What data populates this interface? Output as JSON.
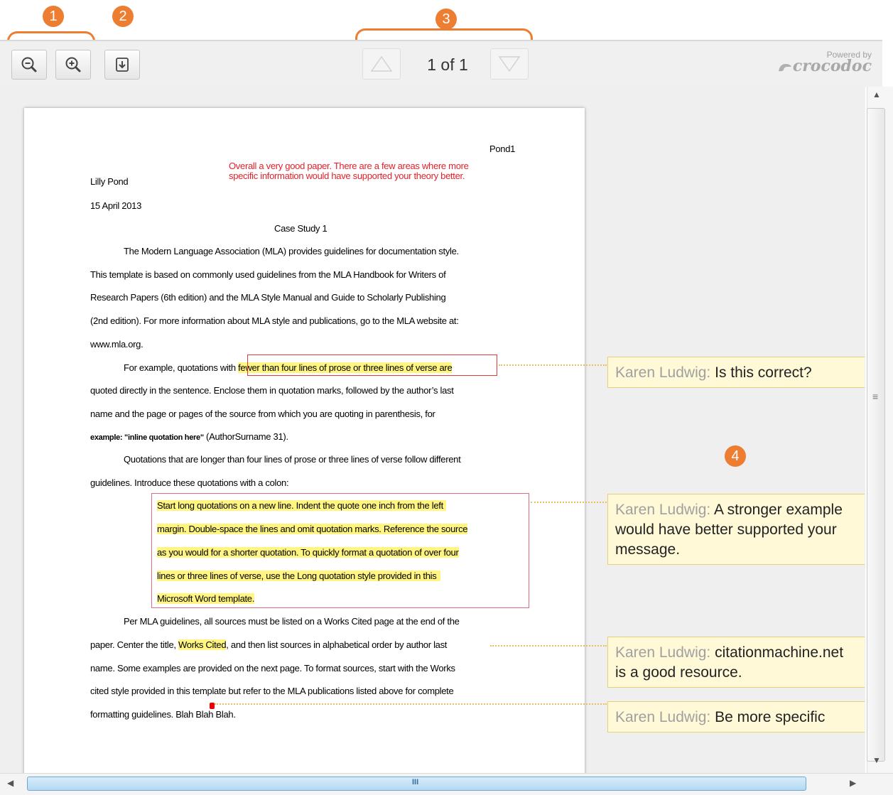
{
  "callouts": [
    "1",
    "2",
    "3",
    "4"
  ],
  "toolbar": {
    "zoom_out_icon": "zoom-out-icon",
    "zoom_in_icon": "zoom-in-icon",
    "download_icon": "download-icon",
    "page_indicator": "1 of 1",
    "brand_powered": "Powered by",
    "brand_name": "crocodoc"
  },
  "document": {
    "header_right": "Pond1",
    "author": "Lilly Pond",
    "date": "15 April 2013",
    "title": "Case Study 1",
    "general_comment": "Overall a very good paper. There are a few areas where more specific information would have supported your theory better.",
    "lines": [
      "The Modern Language Association (MLA) provides guidelines for documentation style.",
      "This template is based on commonly used guidelines from the MLA Handbook for Writers of",
      "Research Papers (6th edition) and the MLA Style Manual and Guide to Scholarly Publishing",
      "(2nd edition). For more information about MLA style and publications, go to the MLA website at:",
      "www.mla.org."
    ],
    "para2_pre": "For example, quotations with ",
    "para2_hl": "fewer than four lines of prose or three lines of verse are",
    "para2_lines": [
      "quoted directly in the sentence. Enclose them in quotation marks, followed by the author’s last",
      "name and the page or pages of the source from which you are quoting in parenthesis, for"
    ],
    "para2_example_code": "example: \"inline quotation here\"",
    "para2_example_rest": " (AuthorSurname 31).",
    "para3_lines": [
      "Quotations that are longer than four lines of prose or three lines of verse follow different",
      "guidelines. Introduce these quotations with a colon:"
    ],
    "block_quote": [
      "Start long quotations on a new line. Indent the quote one inch from the left",
      "margin. Double-space the lines and omit quotation marks. Reference the source",
      "as you would for a shorter quotation. To quickly format a quotation of over four",
      "lines or three lines of verse, use the Long quotation style provided in this",
      "Microsoft Word template."
    ],
    "para4_line1": "Per MLA guidelines, all sources must be listed on a Works Cited page at the end of the",
    "para4_line2_pre": "paper. Center the title, ",
    "para4_line2_hl": "Works Cited",
    "para4_line2_post": ", and then list sources in alphabetical order by author last",
    "para4_lines": [
      "name. Some examples are provided on the next page. To format sources, start with the Works",
      "cited style provided in this template but refer to the MLA publications listed above for complete",
      "formatting guidelines. Blah Blah Blah."
    ]
  },
  "comments": [
    {
      "author": "Karen Ludwig:",
      "text": "Is this correct?"
    },
    {
      "author": "Karen Ludwig:",
      "text": "A stronger example would have better supported your message."
    },
    {
      "author": "Karen Ludwig:",
      "text": "citationmachine.net is a good resource."
    },
    {
      "author": "Karen Ludwig:",
      "text": "Be more specific"
    }
  ],
  "scrollbar": {
    "h_grip": "III",
    "v_grip": "≡"
  }
}
